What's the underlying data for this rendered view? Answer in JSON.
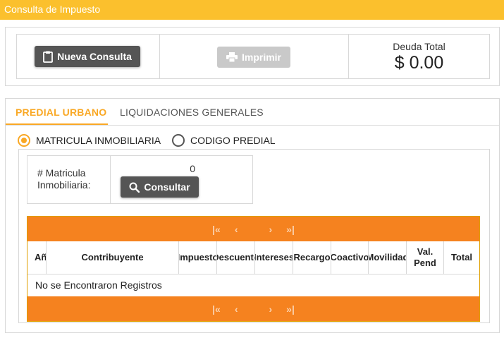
{
  "window": {
    "title": "Consulta de Impuesto"
  },
  "colors": {
    "header_yellow": "#fbc02d",
    "accent_orange": "#f5821f",
    "tab_active": "#f9a825",
    "button_dark": "#555555",
    "button_disabled": "#c9c9c9"
  },
  "toolbar": {
    "new_query": {
      "label": "Nueva Consulta",
      "icon": "clipboard-icon"
    },
    "print": {
      "label": "Imprimir",
      "icon": "printer-icon",
      "enabled": false
    },
    "debt": {
      "label": "Deuda Total",
      "value": "$ 0.00"
    }
  },
  "tabs": [
    {
      "label": "PREDIAL URBANO",
      "active": true
    },
    {
      "label": "LIQUIDACIONES GENERALES",
      "active": false
    }
  ],
  "search_type": {
    "options": [
      {
        "label": "MATRICULA INMOBILIARIA",
        "selected": true
      },
      {
        "label": "CODIGO PREDIAL",
        "selected": false
      }
    ]
  },
  "search": {
    "label_line1": "# Matricula",
    "label_line2": "Inmobiliaria:",
    "value": "0",
    "button": {
      "label": "Consultar",
      "icon": "search-icon"
    }
  },
  "pager": {
    "first": "|«",
    "prev": "‹",
    "next": "›",
    "last": "»|"
  },
  "table": {
    "columns": [
      "Año",
      "Contribuyente",
      "Impuesto",
      "Descuento",
      "Intereses",
      "Recargo",
      "Coactivo",
      "Movilidad",
      "Val. Pend",
      "Total"
    ],
    "empty_message": "No se Encontraron Registros"
  }
}
